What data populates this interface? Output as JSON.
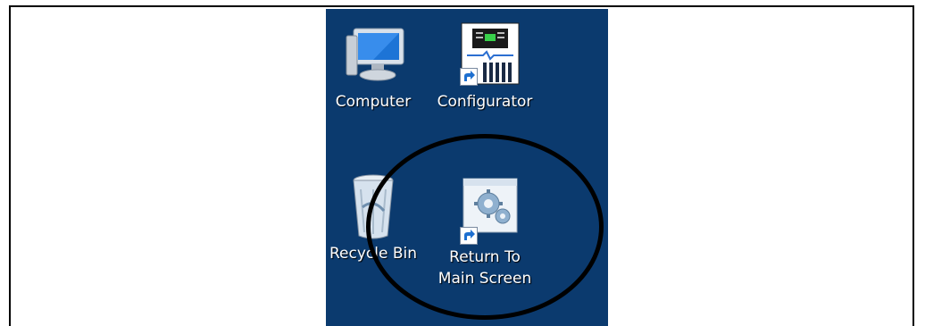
{
  "desktop": {
    "icons": [
      {
        "label": "Computer",
        "icon": "computer-icon"
      },
      {
        "label": "Configurator",
        "icon": "configurator-icon"
      },
      {
        "label": "Recycle Bin",
        "icon": "recycle-bin-icon"
      },
      {
        "label_line1": "Return To",
        "label_line2": "Main Screen",
        "icon": "settings-gears-icon"
      }
    ],
    "background_color": "#0b3a6e",
    "annotation": "hand-drawn circle highlight"
  }
}
